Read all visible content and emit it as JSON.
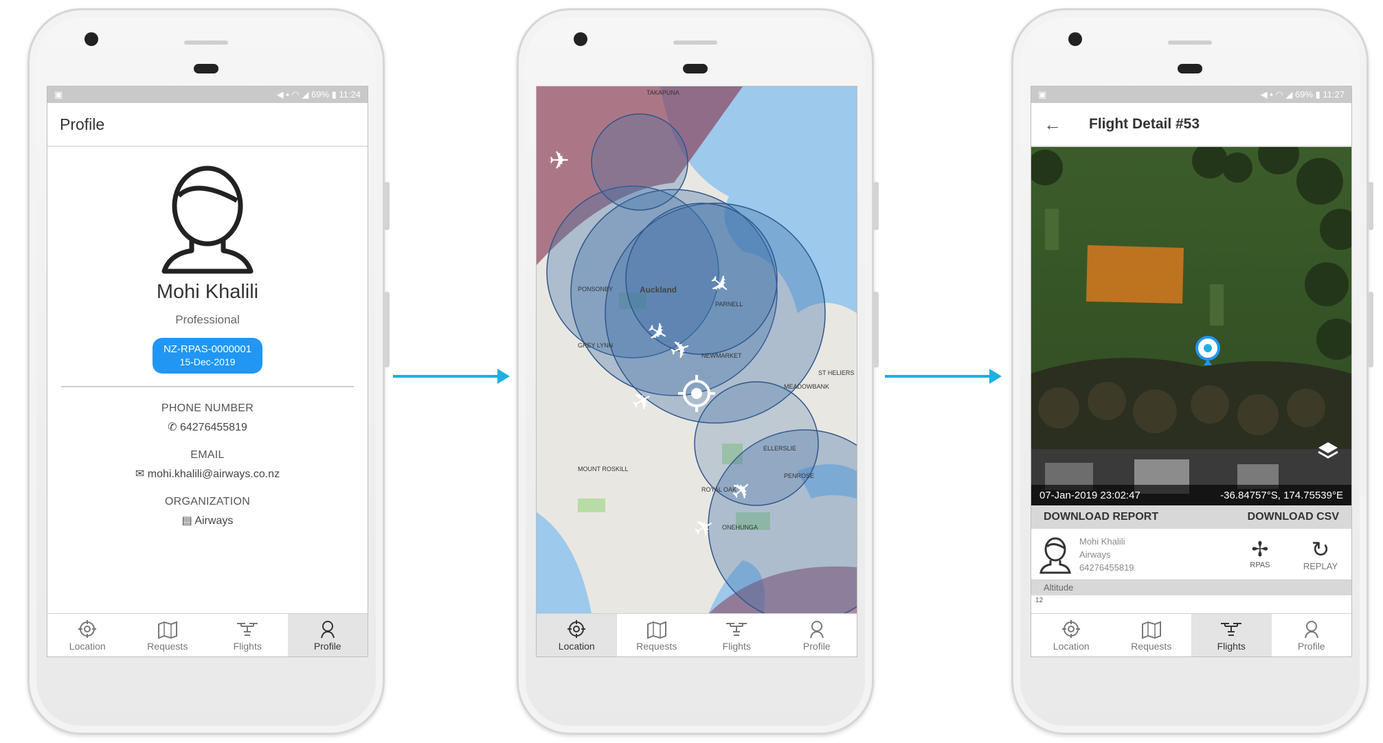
{
  "profile_screen": {
    "status_time": "11:24",
    "status_battery": "69%",
    "title": "Profile",
    "name": "Mohi Khalili",
    "role": "Professional",
    "license_id": "NZ-RPAS-0000001",
    "license_date": "15-Dec-2019",
    "phone_label": "PHONE NUMBER",
    "phone_value": "64276455819",
    "email_label": "EMAIL",
    "email_value": "mohi.khalili@airways.co.nz",
    "org_label": "ORGANIZATION",
    "org_value": "Airways",
    "active_tab": "Profile"
  },
  "map_screen": {
    "place_labels": [
      "Auckland",
      "PARNELL",
      "NEWMARKET",
      "GREY LYNN",
      "PONSONBY",
      "MOUNT ROSKILL",
      "ELLERSLIE",
      "PENROSE",
      "ONEHUNGA",
      "ROYAL OAK",
      "TAKAPUNA",
      "ST HELIERS",
      "MEADOWBANK"
    ],
    "active_tab": "Location"
  },
  "flight_screen": {
    "status_time": "11:27",
    "status_battery": "69%",
    "title": "Flight Detail #53",
    "timestamp": "07-Jan-2019 23:02:47",
    "coordinates": "-36.84757°S, 174.75539°E",
    "download_report": "DOWNLOAD REPORT",
    "download_csv": "DOWNLOAD CSV",
    "pilot_name": "Mohi Khalili",
    "pilot_org": "Airways",
    "pilot_phone": "64276455819",
    "rpas_label": "RPAS",
    "replay_label": "REPLAY",
    "altitude_label": "Altitude",
    "altitude_tick": "12",
    "active_tab": "Flights"
  },
  "nav": {
    "location": "Location",
    "requests": "Requests",
    "flights": "Flights",
    "profile": "Profile"
  },
  "colors": {
    "accent_blue": "#2196f3",
    "arrow_cyan": "#1eb0e0",
    "airspace_blue": "#3f6fa8",
    "restricted_red": "#8a3a55",
    "flight_area_orange": "#e07a1e"
  }
}
